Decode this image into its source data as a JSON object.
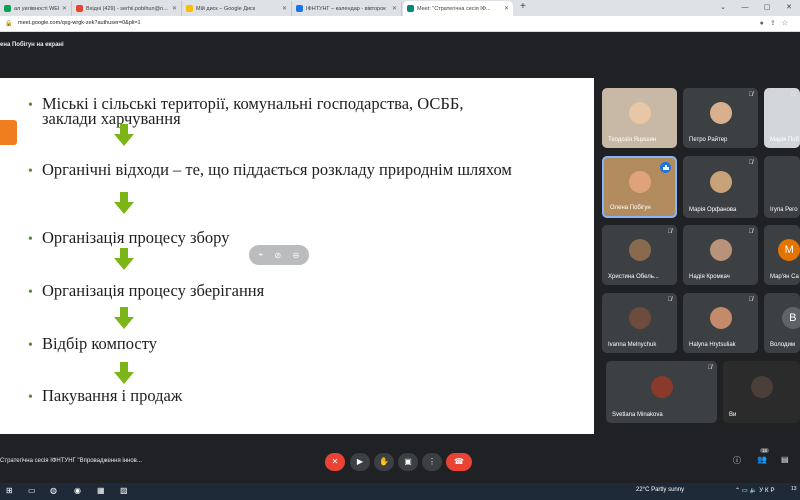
{
  "browser": {
    "tabs": [
      {
        "label": "ал уилівності WEB з 3...",
        "color": "#0f9d58"
      },
      {
        "label": "Вхідні (429) - serhii.pobihun@n...",
        "color": "#ea4335"
      },
      {
        "label": "Мій диск – Google Диск",
        "color": "#fbbc04"
      },
      {
        "label": "ІФНТУНГ – календар - вівторок",
        "color": "#1a73e8"
      },
      {
        "label": "Meet: \"Стратегічна сесія ІФ...",
        "color": "#00897b",
        "active": true
      }
    ],
    "new_tab": "+",
    "url": "meet.google.com/qxg-wrgk-zek?authuser=0&pli=1"
  },
  "meet": {
    "presenter_label": "ена Побігун на екрані",
    "slide": {
      "items": [
        "Міські і сільські території, комунальні господарства, ОСББ, заклади харчування",
        "Органічні відходи – те, що піддається розкладу природнім шляхом",
        "Організація процесу збору",
        "Організація процесу зберігання",
        "Відбір компосту",
        "Пакування і продаж"
      ]
    },
    "participants": [
      {
        "name": "Теодозія Яцишин"
      },
      {
        "name": "Петро Райтер"
      },
      {
        "name": "Марія Поб"
      },
      {
        "name": "Олена Побігун"
      },
      {
        "name": "Марія Орфанова"
      },
      {
        "name": "Ігупа Рего"
      },
      {
        "name": "Христина Обель..."
      },
      {
        "name": "Надія Кромкач"
      },
      {
        "name": "Мар'ян Са",
        "initial": "M"
      },
      {
        "name": "Ivanna Melnychuk"
      },
      {
        "name": "Halyna Hrytsuliak"
      },
      {
        "name": "Володим",
        "initial": "B"
      },
      {
        "name": "Svetlana Minakova"
      },
      {
        "name": "Ви"
      }
    ],
    "meeting_title": "Стратегічна сесія ІФНТУНГ \"Впровадження іннов...",
    "people_count": "16"
  },
  "taskbar": {
    "weather": "22°C  Partly sunny",
    "language": "УКР",
    "time": "13"
  },
  "colors": {
    "accent_blue": "#8ab4f8",
    "end_call_red": "#ea4335",
    "arrow_green": "#7cb518",
    "slide_orange": "#f07d1e"
  }
}
